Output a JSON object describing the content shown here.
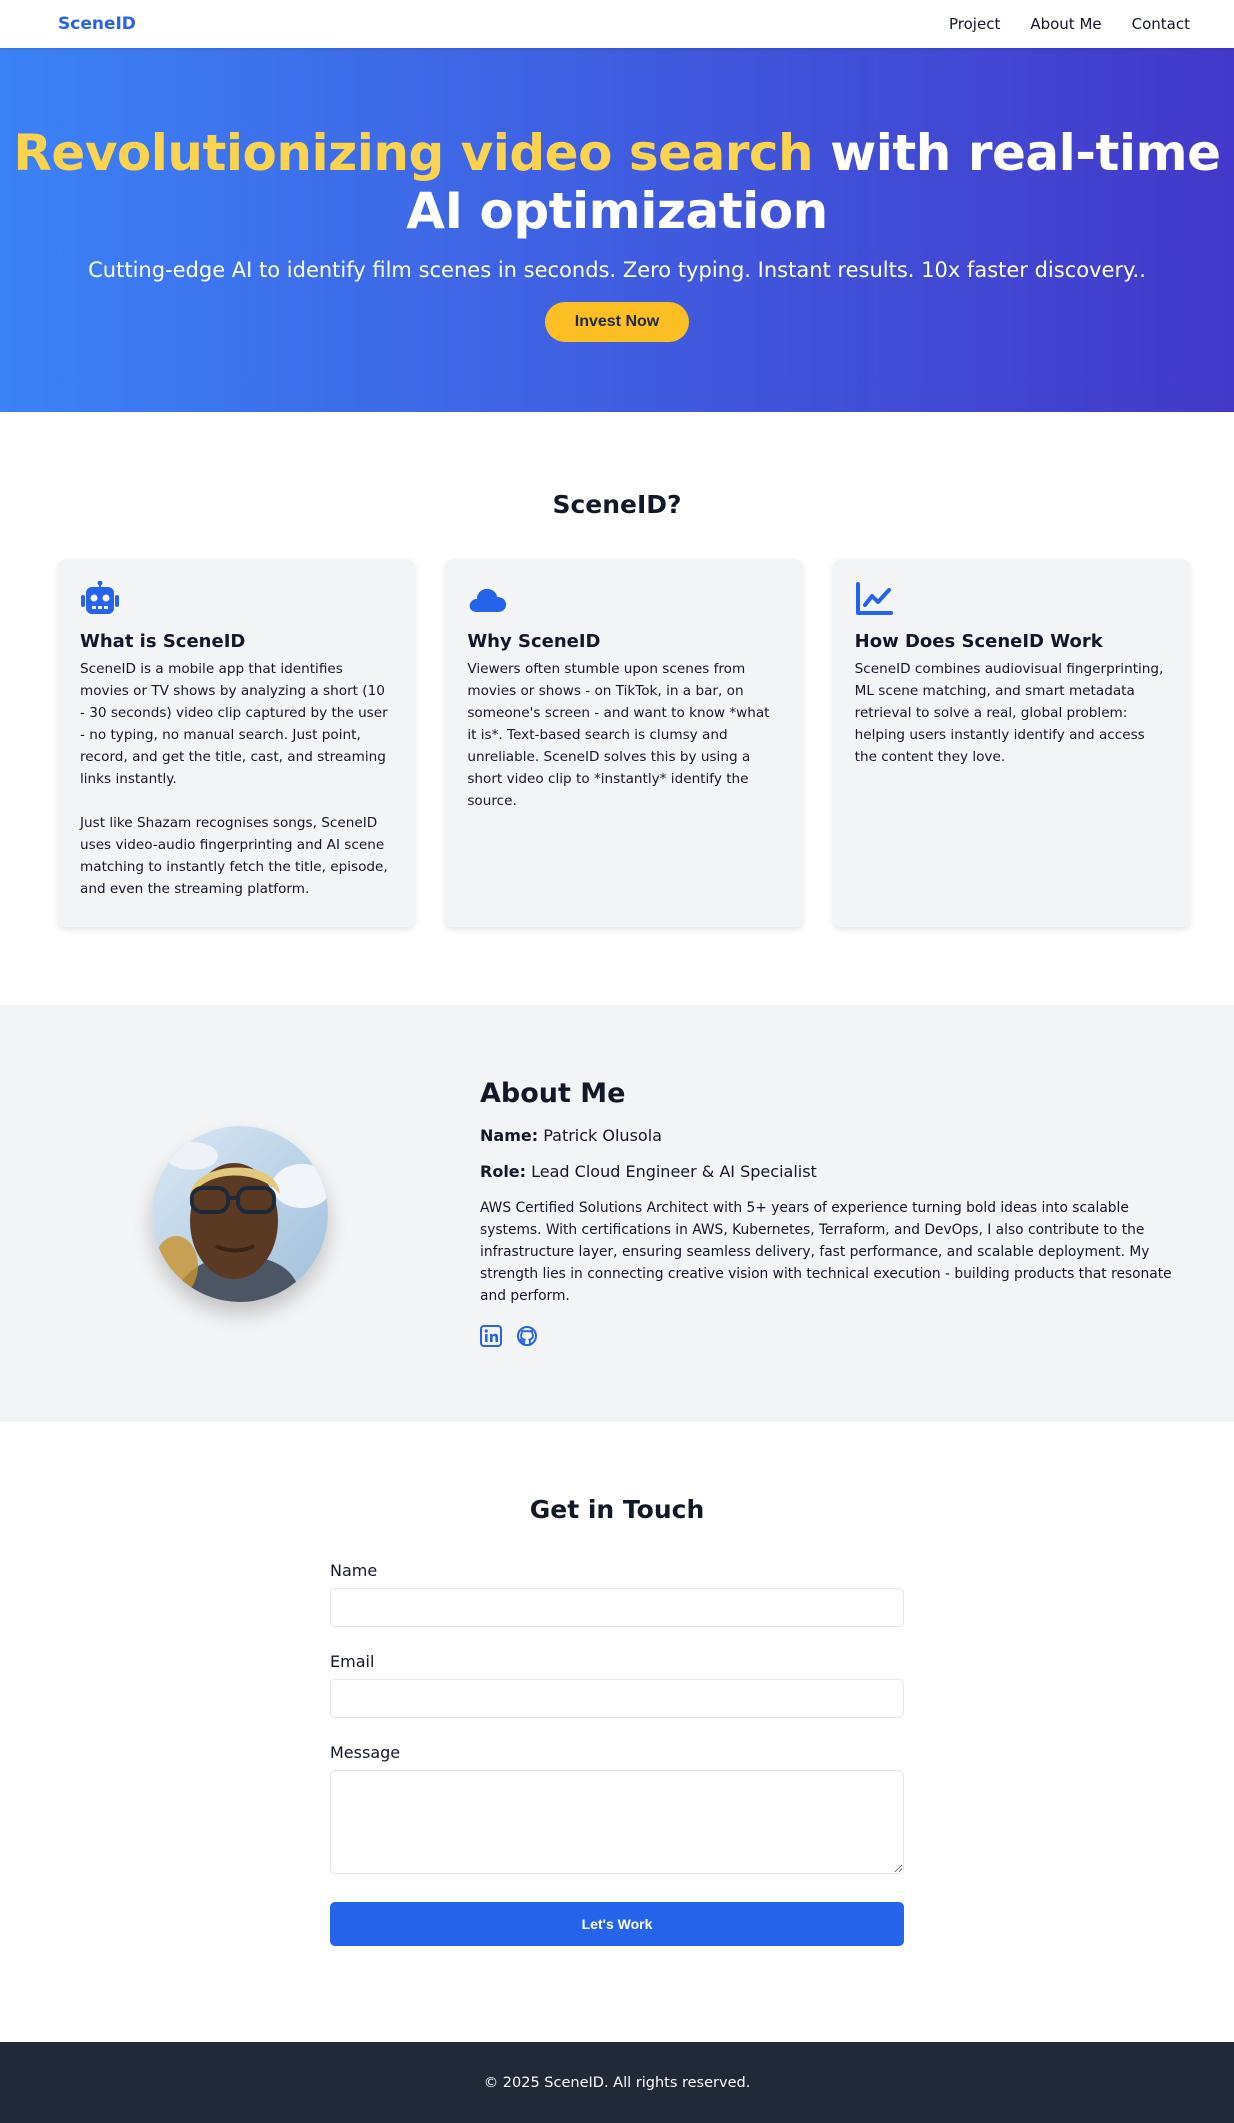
{
  "nav": {
    "brand": "SceneID",
    "links": [
      "Project",
      "About Me",
      "Contact"
    ]
  },
  "hero": {
    "title_highlight": "Revolutionizing video search",
    "title_rest": "with real-time AI optimization",
    "subtitle": "Cutting-edge AI to identify film scenes in seconds. Zero typing. Instant results. 10x faster discovery..",
    "cta": "Invest Now"
  },
  "features": {
    "title": "SceneID?",
    "cards": [
      {
        "icon": "robot-icon",
        "title": "What is SceneID",
        "paragraphs": [
          "SceneID is a mobile app that identifies movies or TV shows by analyzing a short (10 - 30 seconds) video clip captured by the user - no typing, no manual search. Just point, record, and get the title, cast, and streaming links instantly.",
          "Just like Shazam recognises songs, SceneID uses video-audio fingerprinting and AI scene matching to instantly fetch the title, episode, and even the streaming platform."
        ]
      },
      {
        "icon": "cloud-icon",
        "title": "Why SceneID",
        "paragraphs": [
          "Viewers often stumble upon scenes from movies or shows - on TikTok, in a bar, on someone's screen - and want to know *what it is*. Text-based search is clumsy and unreliable. SceneID solves this by using a short video clip to *instantly* identify the source."
        ]
      },
      {
        "icon": "chart-line-icon",
        "title": "How Does SceneID Work",
        "paragraphs": [
          "SceneID combines audiovisual fingerprinting, ML scene matching, and smart metadata retrieval to solve a real, global problem: helping users instantly identify and access the content they love."
        ]
      }
    ]
  },
  "about": {
    "title": "About Me",
    "name_label": "Name:",
    "name": "Patrick Olusola",
    "role_label": "Role:",
    "role": "Lead Cloud Engineer & AI Specialist",
    "bio": "AWS Certified Solutions Architect with 5+ years of experience turning bold ideas into scalable systems. With certifications in AWS, Kubernetes, Terraform, and DevOps, I also contribute to the infrastructure layer, ensuring seamless delivery, fast performance, and scalable deployment. My strength lies in connecting creative vision with technical execution - building products that resonate and perform.",
    "socials": [
      "linkedin-icon",
      "github-icon"
    ]
  },
  "contact": {
    "title": "Get in Touch",
    "name_label": "Name",
    "email_label": "Email",
    "message_label": "Message",
    "submit": "Let's Work"
  },
  "footer": {
    "text": "© 2025 SceneID. All rights reserved."
  },
  "colors": {
    "primary": "#2563eb",
    "accent": "#fbbf24",
    "highlight": "#fcd34d",
    "footer_bg": "#1f2937"
  }
}
